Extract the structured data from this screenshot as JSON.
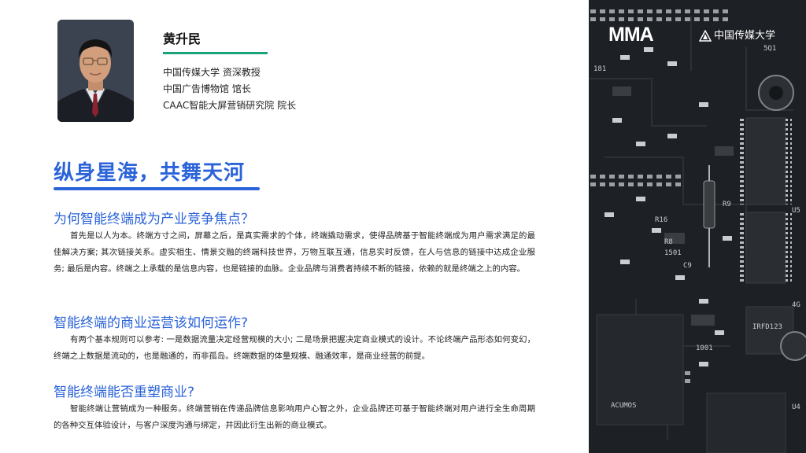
{
  "speaker": {
    "name": "黄升民",
    "titles": [
      "中国传媒大学  资深教授",
      "中国广告博物馆  馆长",
      "CAAC智能大屏营销研究院  院长"
    ]
  },
  "heading": "纵身星海，共舞天河",
  "sections": [
    {
      "title": "为何智能终端成为产业竞争焦点？",
      "body": "首先是以人为本。终端方寸之间，屏幕之后，是真实需求的个体，终端撬动需求，使得品牌基于智能终端成为用户需求满足的最佳解决方案; 其次链接关系。虚实相生、情景交融的终端科技世界，万物互联互通，信息实时反馈，在人与信息的链接中达成企业服务; 最后是内容。终端之上承载的是信息内容，也是链接的血脉。企业品牌与消费者持续不断的链接，依赖的就是终端之上的内容。"
    },
    {
      "title": "智能终端的商业运营该如何运作?",
      "body": "有两个基本规则可以参考: 一是数据流量决定经营规模的大小; 二是场景把握决定商业模式的设计。不论终端产品形态如何变幻，终端之上数据是流动的，也是融通的，而非孤岛。终端数据的体量规模、融通效率，是商业经营的前提。"
    },
    {
      "title": "智能终端能否重塑商业?",
      "body": "智能终端让营销成为一种服务。终端营销在传递品牌信息影响用户心智之外，企业品牌还可基于智能终端对用户进行全生命周期的各种交互体验设计，与客户深度沟通与绑定，并因此衍生出新的商业模式。"
    }
  ],
  "logos": {
    "mma": "MMA",
    "cuc": "中国传媒大学"
  },
  "board_labels": [
    "R8",
    "R16",
    "U5",
    "R9",
    "IRFD123",
    "4G",
    "1001",
    "U4",
    "ACUMOS",
    "1501",
    "5Q1",
    "181",
    "C9"
  ],
  "colors": {
    "accent": "#2b63d9",
    "rule_green": "#1aa37a",
    "board": "#1d2024"
  }
}
